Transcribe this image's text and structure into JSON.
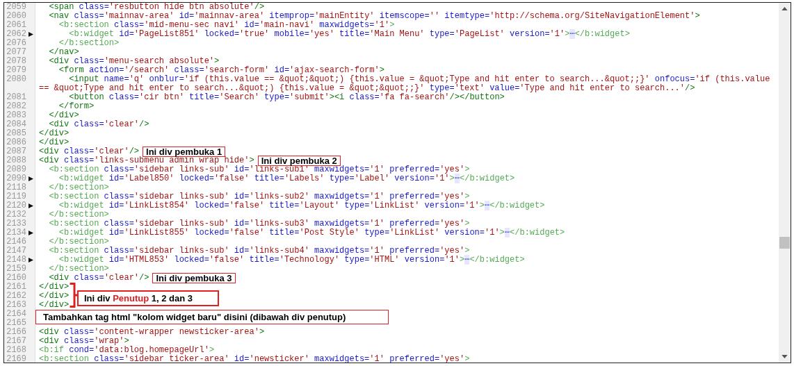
{
  "editor": {
    "lines": [
      {
        "number": "2059",
        "folded": false,
        "tokens": [
          {
            "kind": "tag",
            "text": "  <span"
          },
          {
            "kind": "attr",
            "text": " class="
          },
          {
            "kind": "val",
            "text": "'resbutton hide btn absolute'"
          },
          {
            "kind": "tag",
            "text": "/>"
          }
        ]
      },
      {
        "number": "2060",
        "folded": false,
        "tokens": [
          {
            "kind": "tag",
            "text": "  <nav"
          },
          {
            "kind": "attr",
            "text": " class="
          },
          {
            "kind": "val",
            "text": "'mainnav-area'"
          },
          {
            "kind": "attr",
            "text": " id="
          },
          {
            "kind": "val",
            "text": "'mainnav-area'"
          },
          {
            "kind": "attr",
            "text": " itemprop="
          },
          {
            "kind": "val",
            "text": "'mainEntity'"
          },
          {
            "kind": "attr",
            "text": " itemscope="
          },
          {
            "kind": "val",
            "text": "''"
          },
          {
            "kind": "attr",
            "text": " itemtype="
          },
          {
            "kind": "val",
            "text": "'http://schema.org/SiteNavigationElement'"
          },
          {
            "kind": "tag",
            "text": ">"
          }
        ]
      },
      {
        "number": "2061",
        "folded": false,
        "tokens": [
          {
            "kind": "btag",
            "text": "    <b:section"
          },
          {
            "kind": "attr",
            "text": " class="
          },
          {
            "kind": "val",
            "text": "'mid-menu-sec navi'"
          },
          {
            "kind": "attr",
            "text": " id="
          },
          {
            "kind": "val",
            "text": "'main-navi'"
          },
          {
            "kind": "attr",
            "text": " maxwidgets="
          },
          {
            "kind": "val",
            "text": "'1'"
          },
          {
            "kind": "btag",
            "text": ">"
          }
        ]
      },
      {
        "number": "2062",
        "folded": true,
        "tokens": [
          {
            "kind": "btag",
            "text": "      <b:widget"
          },
          {
            "kind": "attr",
            "text": " id="
          },
          {
            "kind": "val",
            "text": "'PageList851'"
          },
          {
            "kind": "attr",
            "text": " locked="
          },
          {
            "kind": "val",
            "text": "'true'"
          },
          {
            "kind": "attr",
            "text": " mobile="
          },
          {
            "kind": "val",
            "text": "'yes'"
          },
          {
            "kind": "attr",
            "text": " title="
          },
          {
            "kind": "val",
            "text": "'Main Menu'"
          },
          {
            "kind": "attr",
            "text": " type="
          },
          {
            "kind": "val",
            "text": "'PageList'"
          },
          {
            "kind": "attr",
            "text": " version="
          },
          {
            "kind": "val",
            "text": "'1'"
          },
          {
            "kind": "btag",
            "text": ">"
          },
          {
            "kind": "more",
            "text": "⋯"
          },
          {
            "kind": "btag",
            "text": "</b:widget>"
          }
        ]
      },
      {
        "number": "2076",
        "folded": false,
        "tokens": [
          {
            "kind": "btag",
            "text": "    </b:section>"
          }
        ]
      },
      {
        "number": "2077",
        "folded": false,
        "tokens": [
          {
            "kind": "tag",
            "text": "  </nav>"
          }
        ]
      },
      {
        "number": "2078",
        "folded": false,
        "tokens": [
          {
            "kind": "tag",
            "text": "  <div"
          },
          {
            "kind": "attr",
            "text": " class="
          },
          {
            "kind": "val",
            "text": "'menu-search absolute'"
          },
          {
            "kind": "tag",
            "text": ">"
          }
        ]
      },
      {
        "number": "2079",
        "folded": false,
        "tokens": [
          {
            "kind": "tag",
            "text": "    <form"
          },
          {
            "kind": "attr",
            "text": " action="
          },
          {
            "kind": "val",
            "text": "'/search'"
          },
          {
            "kind": "attr",
            "text": " class="
          },
          {
            "kind": "val",
            "text": "'search-form'"
          },
          {
            "kind": "attr",
            "text": " id="
          },
          {
            "kind": "val",
            "text": "'ajax-search-form'"
          },
          {
            "kind": "tag",
            "text": ">"
          }
        ]
      },
      {
        "number": "2080",
        "folded": false,
        "tokens": [
          {
            "kind": "tag",
            "text": "      <input"
          },
          {
            "kind": "attr",
            "text": " name="
          },
          {
            "kind": "val",
            "text": "'q'"
          },
          {
            "kind": "attr",
            "text": " onblur="
          },
          {
            "kind": "val",
            "text": "'if (this.value == &quot;&quot;) {this.value = &quot;Type and hit enter to search...&quot;;}'"
          },
          {
            "kind": "attr",
            "text": " onfocus="
          },
          {
            "kind": "val",
            "text": "'if (this.value"
          }
        ]
      },
      {
        "folded": false,
        "tokens": [
          {
            "kind": "val",
            "text": "== &quot;Type and hit enter to search...&quot;) {this.value = &quot;&quot;;}'"
          },
          {
            "kind": "attr",
            "text": " type="
          },
          {
            "kind": "val",
            "text": "'text'"
          },
          {
            "kind": "attr",
            "text": " value="
          },
          {
            "kind": "val",
            "text": "'Type and hit enter to search...'"
          },
          {
            "kind": "tag",
            "text": "/>"
          }
        ]
      },
      {
        "number": "2081",
        "folded": false,
        "tokens": [
          {
            "kind": "tag",
            "text": "      <button"
          },
          {
            "kind": "attr",
            "text": " class="
          },
          {
            "kind": "val",
            "text": "'cir btn'"
          },
          {
            "kind": "attr",
            "text": " title="
          },
          {
            "kind": "val",
            "text": "'Search'"
          },
          {
            "kind": "attr",
            "text": " type="
          },
          {
            "kind": "val",
            "text": "'submit'"
          },
          {
            "kind": "tag",
            "text": "><i"
          },
          {
            "kind": "attr",
            "text": " class="
          },
          {
            "kind": "val",
            "text": "'fa fa-search'"
          },
          {
            "kind": "tag",
            "text": "/></button>"
          }
        ]
      },
      {
        "number": "2082",
        "folded": false,
        "tokens": [
          {
            "kind": "tag",
            "text": "    </form>"
          }
        ]
      },
      {
        "number": "2083",
        "folded": false,
        "tokens": [
          {
            "kind": "tag",
            "text": "  </div>"
          }
        ]
      },
      {
        "number": "2084",
        "folded": false,
        "tokens": [
          {
            "kind": "tag",
            "text": "  <div"
          },
          {
            "kind": "attr",
            "text": " class="
          },
          {
            "kind": "val",
            "text": "'clear'"
          },
          {
            "kind": "tag",
            "text": "/>"
          }
        ]
      },
      {
        "number": "2085",
        "folded": false,
        "tokens": [
          {
            "kind": "tag",
            "text": "</div>"
          }
        ]
      },
      {
        "number": "2086",
        "folded": false,
        "tokens": [
          {
            "kind": "tag",
            "text": "</div>"
          }
        ]
      },
      {
        "number": "2087",
        "folded": false,
        "tokens": [
          {
            "kind": "tag",
            "text": "<div"
          },
          {
            "kind": "attr",
            "text": " class="
          },
          {
            "kind": "val",
            "text": "'clear'"
          },
          {
            "kind": "tag",
            "text": "/>"
          }
        ],
        "note": "Ini div pembuka 1"
      },
      {
        "number": "2088",
        "folded": false,
        "tokens": [
          {
            "kind": "tag",
            "text": "<div"
          },
          {
            "kind": "attr",
            "text": " class="
          },
          {
            "kind": "val",
            "text": "'links-submenu admin wrap hide'"
          },
          {
            "kind": "tag",
            "text": ">"
          }
        ],
        "note": "Ini div pembuka 2"
      },
      {
        "number": "2089",
        "folded": false,
        "tokens": [
          {
            "kind": "btag",
            "text": "  <b:section"
          },
          {
            "kind": "attr",
            "text": " class="
          },
          {
            "kind": "val",
            "text": "'sidebar links-sub'"
          },
          {
            "kind": "attr",
            "text": " id="
          },
          {
            "kind": "val",
            "text": "'links-sub1'"
          },
          {
            "kind": "attr",
            "text": " maxwidgets="
          },
          {
            "kind": "val",
            "text": "'1'"
          },
          {
            "kind": "attr",
            "text": " preferred="
          },
          {
            "kind": "val",
            "text": "'yes'"
          },
          {
            "kind": "btag",
            "text": ">"
          }
        ]
      },
      {
        "number": "2090",
        "folded": true,
        "tokens": [
          {
            "kind": "btag",
            "text": "    <b:widget"
          },
          {
            "kind": "attr",
            "text": " id="
          },
          {
            "kind": "val",
            "text": "'Label850'"
          },
          {
            "kind": "attr",
            "text": " locked="
          },
          {
            "kind": "val",
            "text": "'false'"
          },
          {
            "kind": "attr",
            "text": " title="
          },
          {
            "kind": "val",
            "text": "'Labels'"
          },
          {
            "kind": "attr",
            "text": " type="
          },
          {
            "kind": "val",
            "text": "'Label'"
          },
          {
            "kind": "attr",
            "text": " version="
          },
          {
            "kind": "val",
            "text": "'1'"
          },
          {
            "kind": "btag",
            "text": ">"
          },
          {
            "kind": "more",
            "text": "⋯"
          },
          {
            "kind": "btag",
            "text": "</b:widget>"
          }
        ]
      },
      {
        "number": "2118",
        "folded": false,
        "tokens": [
          {
            "kind": "btag",
            "text": "  </b:section>"
          }
        ]
      },
      {
        "number": "2119",
        "folded": false,
        "tokens": [
          {
            "kind": "btag",
            "text": "  <b:section"
          },
          {
            "kind": "attr",
            "text": " class="
          },
          {
            "kind": "val",
            "text": "'sidebar links-sub'"
          },
          {
            "kind": "attr",
            "text": " id="
          },
          {
            "kind": "val",
            "text": "'links-sub2'"
          },
          {
            "kind": "attr",
            "text": " maxwidgets="
          },
          {
            "kind": "val",
            "text": "'1'"
          },
          {
            "kind": "attr",
            "text": " preferred="
          },
          {
            "kind": "val",
            "text": "'yes'"
          },
          {
            "kind": "btag",
            "text": ">"
          }
        ]
      },
      {
        "number": "2120",
        "folded": true,
        "tokens": [
          {
            "kind": "btag",
            "text": "    <b:widget"
          },
          {
            "kind": "attr",
            "text": " id="
          },
          {
            "kind": "val",
            "text": "'LinkList854'"
          },
          {
            "kind": "attr",
            "text": " locked="
          },
          {
            "kind": "val",
            "text": "'false'"
          },
          {
            "kind": "attr",
            "text": " title="
          },
          {
            "kind": "val",
            "text": "'Layout'"
          },
          {
            "kind": "attr",
            "text": " type="
          },
          {
            "kind": "val",
            "text": "'LinkList'"
          },
          {
            "kind": "attr",
            "text": " version="
          },
          {
            "kind": "val",
            "text": "'1'"
          },
          {
            "kind": "btag",
            "text": ">"
          },
          {
            "kind": "more",
            "text": "⋯"
          },
          {
            "kind": "btag",
            "text": "</b:widget>"
          }
        ]
      },
      {
        "number": "2132",
        "folded": false,
        "tokens": [
          {
            "kind": "btag",
            "text": "  </b:section>"
          }
        ]
      },
      {
        "number": "2133",
        "folded": false,
        "tokens": [
          {
            "kind": "btag",
            "text": "  <b:section"
          },
          {
            "kind": "attr",
            "text": " class="
          },
          {
            "kind": "val",
            "text": "'sidebar links-sub'"
          },
          {
            "kind": "attr",
            "text": " id="
          },
          {
            "kind": "val",
            "text": "'links-sub3'"
          },
          {
            "kind": "attr",
            "text": " maxwidgets="
          },
          {
            "kind": "val",
            "text": "'1'"
          },
          {
            "kind": "attr",
            "text": " preferred="
          },
          {
            "kind": "val",
            "text": "'yes'"
          },
          {
            "kind": "btag",
            "text": ">"
          }
        ]
      },
      {
        "number": "2134",
        "folded": true,
        "tokens": [
          {
            "kind": "btag",
            "text": "    <b:widget"
          },
          {
            "kind": "attr",
            "text": " id="
          },
          {
            "kind": "val",
            "text": "'LinkList855'"
          },
          {
            "kind": "attr",
            "text": " locked="
          },
          {
            "kind": "val",
            "text": "'false'"
          },
          {
            "kind": "attr",
            "text": " title="
          },
          {
            "kind": "val",
            "text": "'Post Style'"
          },
          {
            "kind": "attr",
            "text": " type="
          },
          {
            "kind": "val",
            "text": "'LinkList'"
          },
          {
            "kind": "attr",
            "text": " version="
          },
          {
            "kind": "val",
            "text": "'1'"
          },
          {
            "kind": "btag",
            "text": ">"
          },
          {
            "kind": "more",
            "text": "⋯"
          },
          {
            "kind": "btag",
            "text": "</b:widget>"
          }
        ]
      },
      {
        "number": "2146",
        "folded": false,
        "tokens": [
          {
            "kind": "btag",
            "text": "  </b:section>"
          }
        ]
      },
      {
        "number": "2147",
        "folded": false,
        "tokens": [
          {
            "kind": "btag",
            "text": "  <b:section"
          },
          {
            "kind": "attr",
            "text": " class="
          },
          {
            "kind": "val",
            "text": "'sidebar links-sub'"
          },
          {
            "kind": "attr",
            "text": " id="
          },
          {
            "kind": "val",
            "text": "'links-sub4'"
          },
          {
            "kind": "attr",
            "text": " maxwidgets="
          },
          {
            "kind": "val",
            "text": "'1'"
          },
          {
            "kind": "attr",
            "text": " preferred="
          },
          {
            "kind": "val",
            "text": "'yes'"
          },
          {
            "kind": "btag",
            "text": ">"
          }
        ]
      },
      {
        "number": "2148",
        "folded": true,
        "tokens": [
          {
            "kind": "btag",
            "text": "    <b:widget"
          },
          {
            "kind": "attr",
            "text": " id="
          },
          {
            "kind": "val",
            "text": "'HTML853'"
          },
          {
            "kind": "attr",
            "text": " locked="
          },
          {
            "kind": "val",
            "text": "'false'"
          },
          {
            "kind": "attr",
            "text": " title="
          },
          {
            "kind": "val",
            "text": "'Technology'"
          },
          {
            "kind": "attr",
            "text": " type="
          },
          {
            "kind": "val",
            "text": "'HTML'"
          },
          {
            "kind": "attr",
            "text": " version="
          },
          {
            "kind": "val",
            "text": "'1'"
          },
          {
            "kind": "btag",
            "text": ">"
          },
          {
            "kind": "more",
            "text": "⋯"
          },
          {
            "kind": "btag",
            "text": "</b:widget>"
          }
        ]
      },
      {
        "number": "2159",
        "folded": false,
        "tokens": [
          {
            "kind": "btag",
            "text": "  </b:section>"
          }
        ]
      },
      {
        "number": "2160",
        "folded": false,
        "tokens": [
          {
            "kind": "tag",
            "text": "  <div"
          },
          {
            "kind": "attr",
            "text": " class="
          },
          {
            "kind": "val",
            "text": "'clear'"
          },
          {
            "kind": "tag",
            "text": "/>"
          }
        ],
        "note": "Ini div pembuka 3"
      },
      {
        "number": "2161",
        "folded": false,
        "tokens": [
          {
            "kind": "tag",
            "text": "</div>"
          }
        ]
      },
      {
        "number": "2162",
        "folded": false,
        "tokens": [
          {
            "kind": "tag",
            "text": "</div>"
          }
        ]
      },
      {
        "number": "2163",
        "folded": false,
        "tokens": [
          {
            "kind": "tag",
            "text": "</div>"
          }
        ]
      },
      {
        "number": "2164",
        "folded": false
      },
      {
        "number": "2165",
        "folded": false
      },
      {
        "number": "2166",
        "folded": false,
        "tokens": [
          {
            "kind": "tag",
            "text": "<div"
          },
          {
            "kind": "attr",
            "text": " class="
          },
          {
            "kind": "val",
            "text": "'content-wrapper newsticker-area'"
          },
          {
            "kind": "tag",
            "text": ">"
          }
        ]
      },
      {
        "number": "2167",
        "folded": false,
        "tokens": [
          {
            "kind": "tag",
            "text": "<div"
          },
          {
            "kind": "attr",
            "text": " class="
          },
          {
            "kind": "val",
            "text": "'wrap'"
          },
          {
            "kind": "tag",
            "text": ">"
          }
        ]
      },
      {
        "number": "2168",
        "folded": false,
        "tokens": [
          {
            "kind": "btag",
            "text": "<b:if"
          },
          {
            "kind": "attr",
            "text": " cond="
          },
          {
            "kind": "val",
            "text": "'data:blog.homepageUrl'"
          },
          {
            "kind": "btag",
            "text": ">"
          }
        ]
      },
      {
        "number": "2169",
        "folded": false,
        "tokens": [
          {
            "kind": "btag",
            "text": "<b:section"
          },
          {
            "kind": "attr",
            "text": " class="
          },
          {
            "kind": "val",
            "text": "'sidebar ticker-area'"
          },
          {
            "kind": "attr",
            "text": " id="
          },
          {
            "kind": "val",
            "text": "'newsticker'"
          },
          {
            "kind": "attr",
            "text": " maxwidgets="
          },
          {
            "kind": "val",
            "text": "'1'"
          },
          {
            "kind": "attr",
            "text": " preferred="
          },
          {
            "kind": "val",
            "text": "'yes'"
          },
          {
            "kind": "btag",
            "text": ">"
          }
        ]
      }
    ]
  },
  "closing_note": {
    "before": "Ini div",
    "highlight": "Penutup",
    "after": "1, 2 dan 3"
  },
  "insert_note": "Tambahkan tag html \"kolom widget baru\" disini (dibawah div penutup)"
}
